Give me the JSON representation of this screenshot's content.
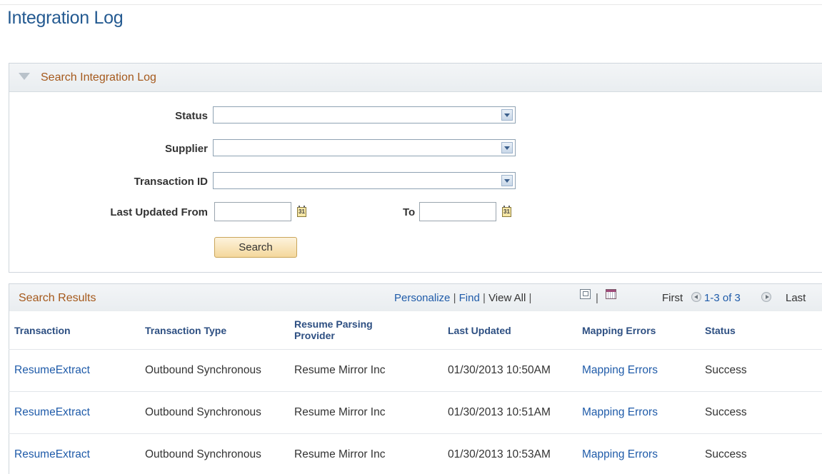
{
  "page": {
    "title": "Integration Log"
  },
  "search_section": {
    "header": "Search Integration Log",
    "fields": {
      "status_label": "Status",
      "status_value": "",
      "supplier_label": "Supplier",
      "supplier_value": "",
      "transaction_id_label": "Transaction ID",
      "transaction_id_value": "",
      "last_updated_from_label": "Last Updated From",
      "last_updated_from_value": "",
      "to_label": "To",
      "to_value": ""
    },
    "search_button": "Search"
  },
  "results_section": {
    "header": "Search Results",
    "toolbar": {
      "personalize": "Personalize",
      "find": "Find",
      "view_all": "View All",
      "first": "First",
      "range": "1-3 of 3",
      "last": "Last"
    },
    "columns": [
      "Transaction",
      "Transaction Type",
      "Resume Parsing Provider",
      "Last Updated",
      "Mapping Errors",
      "Status"
    ],
    "rows": [
      {
        "transaction": "ResumeExtract",
        "type": "Outbound Synchronous",
        "provider": "Resume Mirror Inc",
        "last_updated": "01/30/2013 10:50AM",
        "mapping_errors": "Mapping Errors",
        "status": "Success"
      },
      {
        "transaction": "ResumeExtract",
        "type": "Outbound Synchronous",
        "provider": "Resume Mirror Inc",
        "last_updated": "01/30/2013 10:51AM",
        "mapping_errors": "Mapping Errors",
        "status": "Success"
      },
      {
        "transaction": "ResumeExtract",
        "type": "Outbound Synchronous",
        "provider": "Resume Mirror Inc",
        "last_updated": "01/30/2013 10:53AM",
        "mapping_errors": "Mapping Errors",
        "status": "Success"
      }
    ]
  },
  "colors": {
    "title": "#245a91",
    "section_header_text": "#a5591c",
    "link": "#1f5ba9",
    "button": "#f4d89c"
  }
}
